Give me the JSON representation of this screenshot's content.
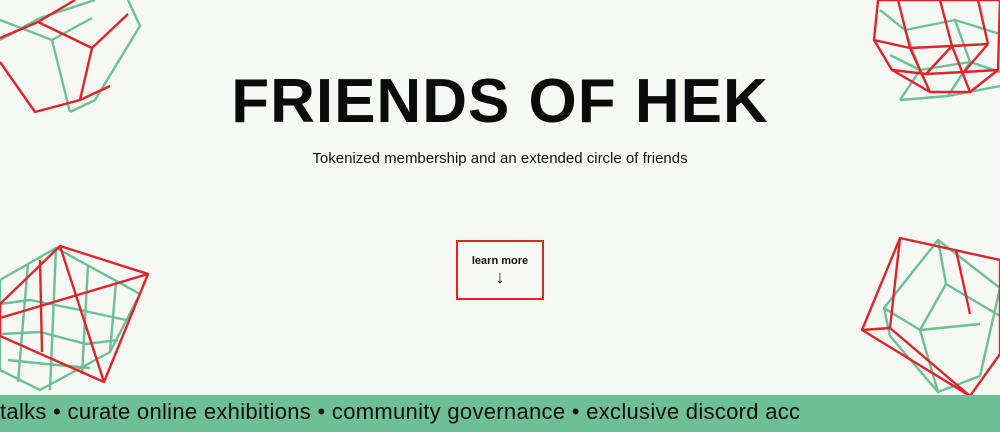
{
  "hero": {
    "title": "FRIENDS OF HEK",
    "subtitle": "Tokenized membership and an extended circle of friends"
  },
  "cta": {
    "label": "learn more",
    "arrow": "↓"
  },
  "ticker": {
    "items": [
      "talks",
      "curate online exhibitions",
      "community governance",
      "exclusive discord acc"
    ],
    "text": "talks • curate online exhibitions •  community governance • exclusive discord acc"
  },
  "colors": {
    "background": "#f6f8f4",
    "accent_red": "#e0242b",
    "accent_green": "#6dbf95",
    "text": "#0b0b0b"
  },
  "icons": {
    "cta_arrow": "arrow-down-icon",
    "decorations": [
      "wireframe-cube-icon",
      "wireframe-sphere-icon",
      "wireframe-grid-icon",
      "wireframe-cube-icon"
    ]
  }
}
